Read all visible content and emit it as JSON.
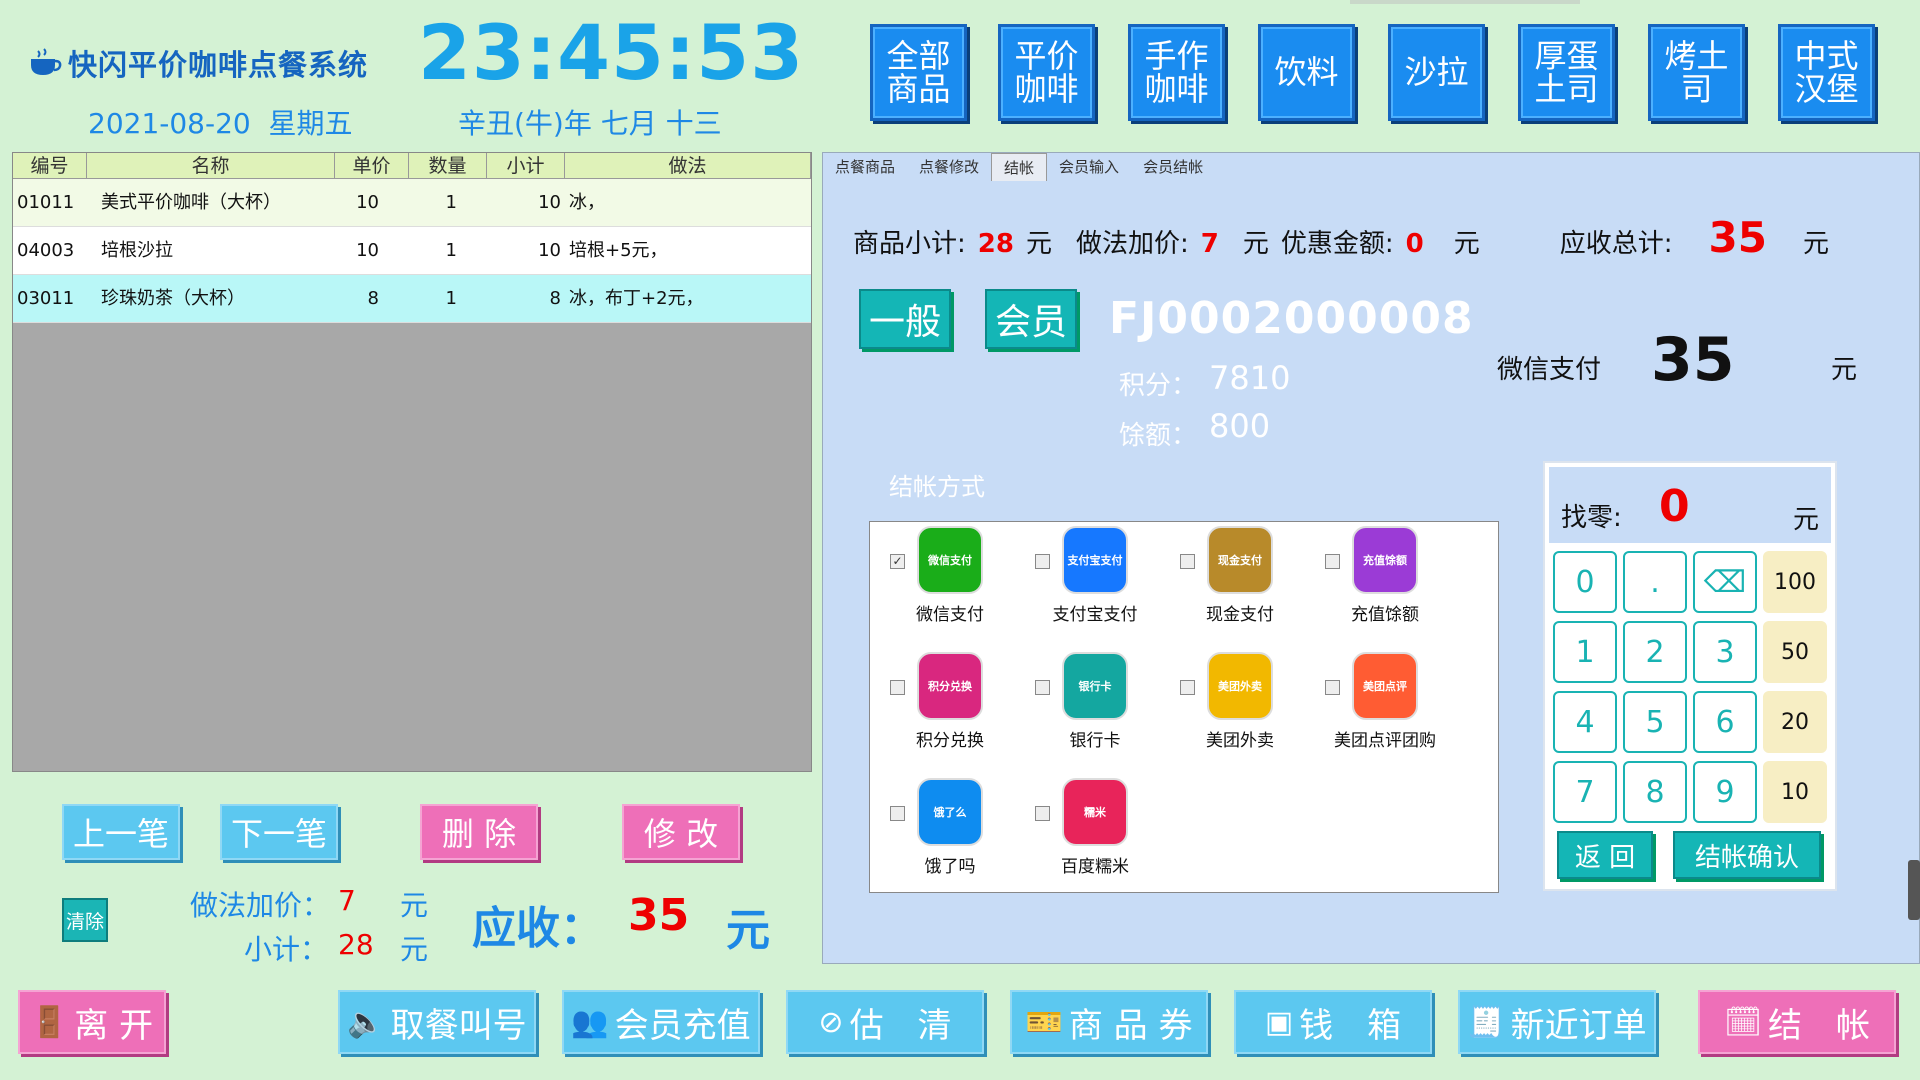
{
  "header": {
    "logo_text": "快闪平价咖啡点餐系统",
    "clock": "23:45:53",
    "date": "2021-08-20",
    "weekday": "星期五",
    "lunar": "辛丑(牛)年 七月 十三"
  },
  "categories": [
    "全部商品",
    "平价咖啡",
    "手作咖啡",
    "饮料",
    "沙拉",
    "厚蛋土司",
    "烤土司",
    "中式汉堡"
  ],
  "order_table": {
    "columns": [
      "编号",
      "名称",
      "单价",
      "数量",
      "小计",
      "做法"
    ],
    "rows": [
      {
        "id": "01011",
        "name": "美式平价咖啡（大杯）",
        "price": "10",
        "qty": "1",
        "subtotal": "10",
        "method": "冰，"
      },
      {
        "id": "04003",
        "name": "培根沙拉",
        "price": "10",
        "qty": "1",
        "subtotal": "10",
        "method": "培根+5元，"
      },
      {
        "id": "03011",
        "name": "珍珠奶茶（大杯）",
        "price": "8",
        "qty": "1",
        "subtotal": "8",
        "method": "冰，布丁+2元，"
      }
    ]
  },
  "order_actions": {
    "prev": "上一笔",
    "next": "下一笔",
    "delete": "删 除",
    "modify": "修 改",
    "clear": "清除"
  },
  "order_summary": {
    "method_label": "做法加价：",
    "method_value": "7",
    "unit": "元",
    "subtotal_label": "小计：",
    "subtotal_value": "28",
    "receivable_label": "应收：",
    "receivable_value": "35",
    "receivable_unit": "元"
  },
  "tabs": [
    "点餐商品",
    "点餐修改",
    "结帐",
    "会员输入",
    "会员结帐"
  ],
  "checkout": {
    "goods_label": "商品小计:",
    "goods_value": "28",
    "method_label": "做法加价:",
    "method_value": "7",
    "discount_label": "优惠金额:",
    "discount_value": "0",
    "total_label": "应收总计:",
    "total_value": "35",
    "unit": "元",
    "general_btn": "一般",
    "member_btn": "会员",
    "member_id": "FJ0002000008",
    "points_label": "积分：",
    "points_value": "7810",
    "balance_label": "馀额：",
    "balance_value": "800",
    "pay_method_label": "微信支付",
    "pay_amount": "35",
    "methods_title": "结帐方式"
  },
  "payment_methods": [
    {
      "name": "微信支付",
      "icon_text": "微信支付",
      "checked": "✓",
      "color": "#1aad19"
    },
    {
      "name": "支付宝支付",
      "icon_text": "支付宝支付",
      "checked": "",
      "color": "#1678ff"
    },
    {
      "name": "现金支付",
      "icon_text": "现金支付",
      "checked": "",
      "color": "#b88a2a"
    },
    {
      "name": "充值馀额",
      "icon_text": "充值馀额",
      "checked": "",
      "color": "#9b3bd6"
    },
    {
      "name": "积分兑换",
      "icon_text": "积分兑换",
      "checked": "",
      "color": "#d9277f"
    },
    {
      "name": "银行卡",
      "icon_text": "银行卡",
      "checked": "",
      "color": "#14a7a0"
    },
    {
      "name": "美团外卖",
      "icon_text": "美团外卖",
      "checked": "",
      "color": "#f2b800"
    },
    {
      "name": "美团点评团购",
      "icon_text": "美团点评",
      "checked": "",
      "color": "#ff5c33"
    },
    {
      "name": "饿了吗",
      "icon_text": "饿了么",
      "checked": "",
      "color": "#0e8cf0"
    },
    {
      "name": "百度糯米",
      "icon_text": "糯米",
      "checked": "",
      "color": "#e8245a"
    }
  ],
  "keypad": {
    "change_label": "找零:",
    "change_value": "0",
    "unit": "元",
    "keys": [
      "0",
      ".",
      "⌫",
      "100",
      "1",
      "2",
      "3",
      "50",
      "4",
      "5",
      "6",
      "20",
      "7",
      "8",
      "9",
      "10"
    ],
    "back": "返 回",
    "confirm": "结帐确认"
  },
  "bottom_bar": {
    "leave": "离 开",
    "call": "取餐叫号",
    "recharge": "会员充值",
    "sold_out": "估　清",
    "voucher": "商 品 券",
    "cashbox": "钱　箱",
    "recent": "新近订单",
    "checkout": "结　帐"
  }
}
